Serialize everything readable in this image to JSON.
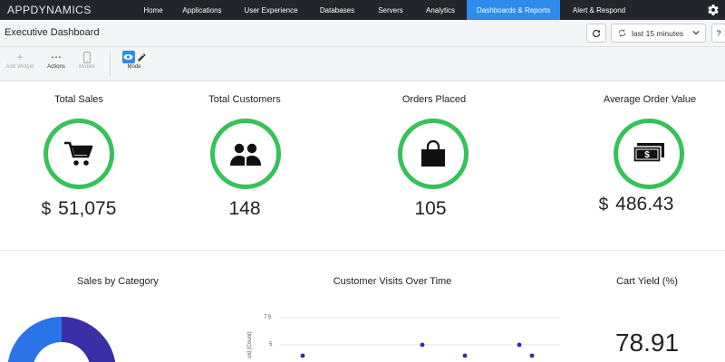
{
  "nav": {
    "logo": "APPDYNAMICS",
    "items": [
      {
        "label": "Home",
        "active": false
      },
      {
        "label": "Applications",
        "active": false
      },
      {
        "label": "User Experience",
        "active": false
      },
      {
        "label": "Databases",
        "active": false
      },
      {
        "label": "Servers",
        "active": false
      },
      {
        "label": "Analytics",
        "active": false
      },
      {
        "label": "Dashboards & Reports",
        "active": true
      },
      {
        "label": "Alert & Respond",
        "active": false
      }
    ],
    "settings_icon": "gear-icon"
  },
  "header": {
    "title": "Executive Dashboard",
    "time_range": "last 15 minutes",
    "help": "?"
  },
  "toolbar": {
    "add_widget": "Add Widget",
    "actions": "Actions",
    "mobile": "Mobile",
    "mode": "Mode"
  },
  "kpis": [
    {
      "title": "Total Sales",
      "prefix": "$",
      "value": "51,075",
      "icon": "shopping-cart-icon"
    },
    {
      "title": "Total Customers",
      "prefix": "",
      "value": "148",
      "icon": "users-icon"
    },
    {
      "title": "Orders Placed",
      "prefix": "",
      "value": "105",
      "icon": "shopping-bag-icon"
    },
    {
      "title": "Average Order Value",
      "prefix": "$",
      "value": "486.43",
      "icon": "money-icon"
    }
  ],
  "widgets": {
    "sales_by_category": {
      "title": "Sales by Category"
    },
    "customer_visits": {
      "title": "Customer Visits Over Time",
      "y_ticks": [
        "7.5",
        "5"
      ],
      "ylabel": "uid (Count)"
    },
    "cart_yield": {
      "title": "Cart Yield (%)",
      "value": "78.91"
    }
  },
  "chart_data": {
    "type": "scatter",
    "title": "Customer Visits Over Time",
    "ylabel": "uid (Count)",
    "ylim": [
      0,
      7.5
    ],
    "y_ticks": [
      7.5,
      5
    ],
    "series": [
      {
        "values": [
          4,
          5,
          4,
          5,
          4
        ]
      }
    ],
    "grid": true
  },
  "colors": {
    "nav_bg": "#22262b",
    "nav_active": "#2d8ceb",
    "ring": "#35c25a",
    "donut_blue": "#2a73e8",
    "donut_purple": "#3b2fa8",
    "points": "#2f2aa6"
  }
}
